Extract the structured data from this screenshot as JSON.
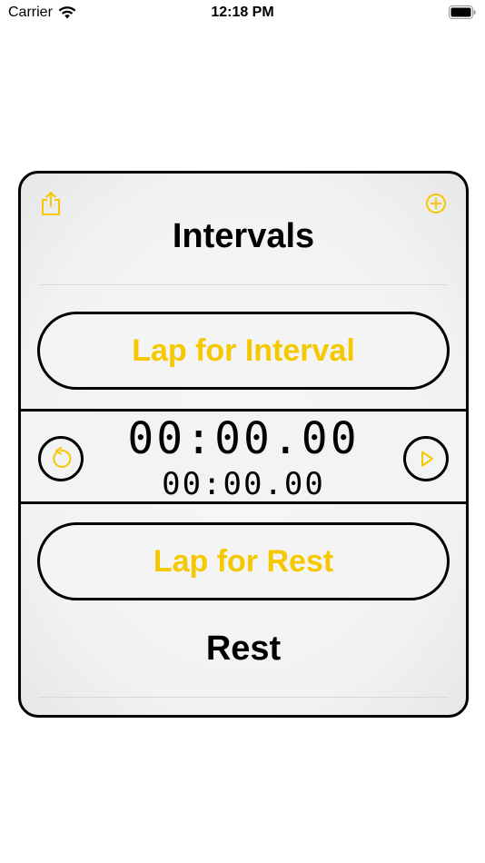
{
  "status_bar": {
    "carrier": "Carrier",
    "time": "12:18 PM"
  },
  "card": {
    "title": "Intervals",
    "share_icon": "share-icon",
    "add_icon": "plus-circle-icon",
    "lap_interval_label": "Lap for Interval",
    "lap_rest_label": "Lap for Rest",
    "main_time": "00:00.00",
    "sub_time": "00:00.00",
    "reset_icon": "reset-icon",
    "play_icon": "play-icon",
    "rest_label": "Rest"
  },
  "colors": {
    "accent": "#f5c800",
    "border": "#000000",
    "card_bg": "#f2f2f2"
  }
}
